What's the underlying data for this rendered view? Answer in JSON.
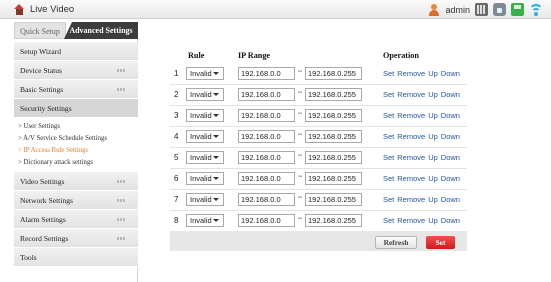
{
  "topbar": {
    "title": "Live Video",
    "user": "admin",
    "icons": [
      "home-icon",
      "user-icon",
      "grid-icon",
      "lock-icon",
      "disk-icon",
      "wifi-icon"
    ]
  },
  "tabs": {
    "quick": "Quick Setup",
    "advanced": "Advanced Settings"
  },
  "sidebar": {
    "items": [
      {
        "label": "Setup Wizard",
        "dots": false
      },
      {
        "label": "Device Status",
        "dots": true
      },
      {
        "label": "Basic Settings",
        "dots": true
      },
      {
        "label": "Security Settings",
        "dots": false,
        "active": true
      },
      {
        "label": "Video Settings",
        "dots": true
      },
      {
        "label": "Network Settings",
        "dots": true
      },
      {
        "label": "Alarm Settings",
        "dots": true
      },
      {
        "label": "Record Settings",
        "dots": true
      },
      {
        "label": "Tools",
        "dots": false
      }
    ],
    "security_sub": [
      "> User Settings",
      "> A/V Service Schedule Settings",
      "> IP Access Rule Settings",
      "> Dictionary attack settings"
    ]
  },
  "table": {
    "headers": {
      "rule": "Rule",
      "ip_range": "IP Range",
      "operation": "Operation"
    },
    "rows": [
      {
        "num": "1",
        "rule": "Invalid",
        "ip_from": "192.168.0.0",
        "ip_to": "192.168.0.255"
      },
      {
        "num": "2",
        "rule": "Invalid",
        "ip_from": "192.168.0.0",
        "ip_to": "192.168.0.255"
      },
      {
        "num": "3",
        "rule": "Invalid",
        "ip_from": "192.168.0.0",
        "ip_to": "192.168.0.255"
      },
      {
        "num": "4",
        "rule": "Invalid",
        "ip_from": "192.168.0.0",
        "ip_to": "192.168.0.255"
      },
      {
        "num": "5",
        "rule": "Invalid",
        "ip_from": "192.168.0.0",
        "ip_to": "192.168.0.255"
      },
      {
        "num": "6",
        "rule": "Invalid",
        "ip_from": "192.168.0.0",
        "ip_to": "192.168.0.255"
      },
      {
        "num": "7",
        "rule": "Invalid",
        "ip_from": "192.168.0.0",
        "ip_to": "192.168.0.255"
      },
      {
        "num": "8",
        "rule": "Invalid",
        "ip_from": "192.168.0.0",
        "ip_to": "192.168.0.255"
      }
    ],
    "operations": [
      "Set",
      "Remove",
      "Up",
      "Down"
    ],
    "range_separator": "~"
  },
  "buttons": {
    "refresh": "Refresh",
    "set": "Set"
  },
  "colors": {
    "accent_red": "#d41a1a",
    "link_blue": "#2456a8",
    "active_sub": "#ef7b2a",
    "tab_dark": "#3c3c3c"
  }
}
